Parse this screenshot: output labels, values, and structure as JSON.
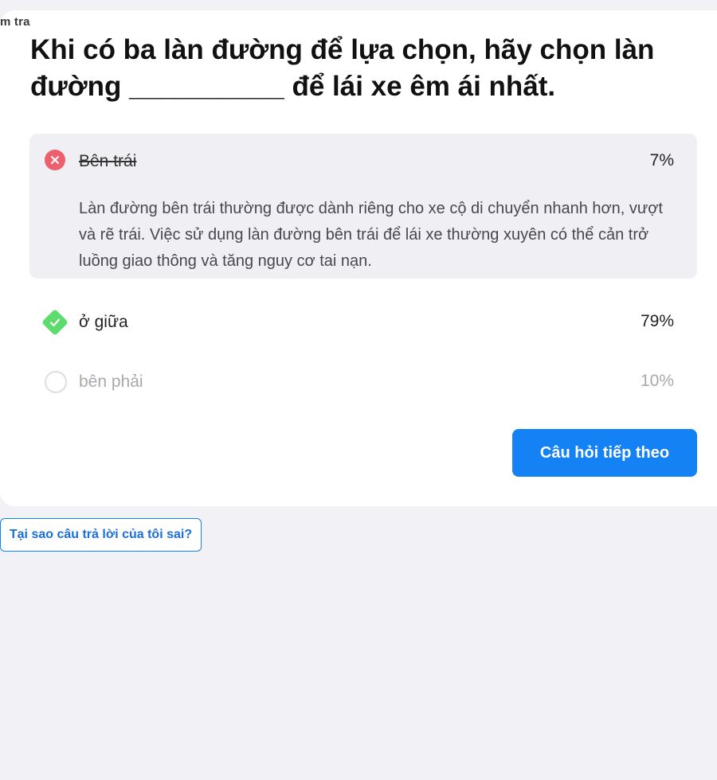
{
  "breadcrumb": "m tra",
  "question": "Khi có ba làn đường để lựa chọn, hãy chọn làn đường __________ để lái xe êm ái nhất.",
  "options": [
    {
      "label": "Bên trái",
      "percent": "7%",
      "state": "incorrect",
      "explanation": "Làn đường bên trái thường được dành riêng cho xe cộ di chuyển nhanh hơn, vượt và rẽ trái. Việc sử dụng làn đường bên trái để lái xe thường xuyên có thể cản trở luồng giao thông và tăng nguy cơ tai nạn.",
      "icon": "x-circle-icon"
    },
    {
      "label": "ở giữa",
      "percent": "79%",
      "state": "correct",
      "icon": "check-diamond-icon"
    },
    {
      "label": "bên phải",
      "percent": "10%",
      "state": "unselected",
      "icon": "empty-circle-icon"
    }
  ],
  "buttons": {
    "next": "Câu hỏi tiếp theo",
    "why_wrong": "Tại sao câu trả lời của tôi sai?"
  },
  "colors": {
    "accent": "#1482f5",
    "incorrect": "#ee5f6e",
    "correct": "#5bdc6d",
    "page_background": "#f1f1f6"
  }
}
